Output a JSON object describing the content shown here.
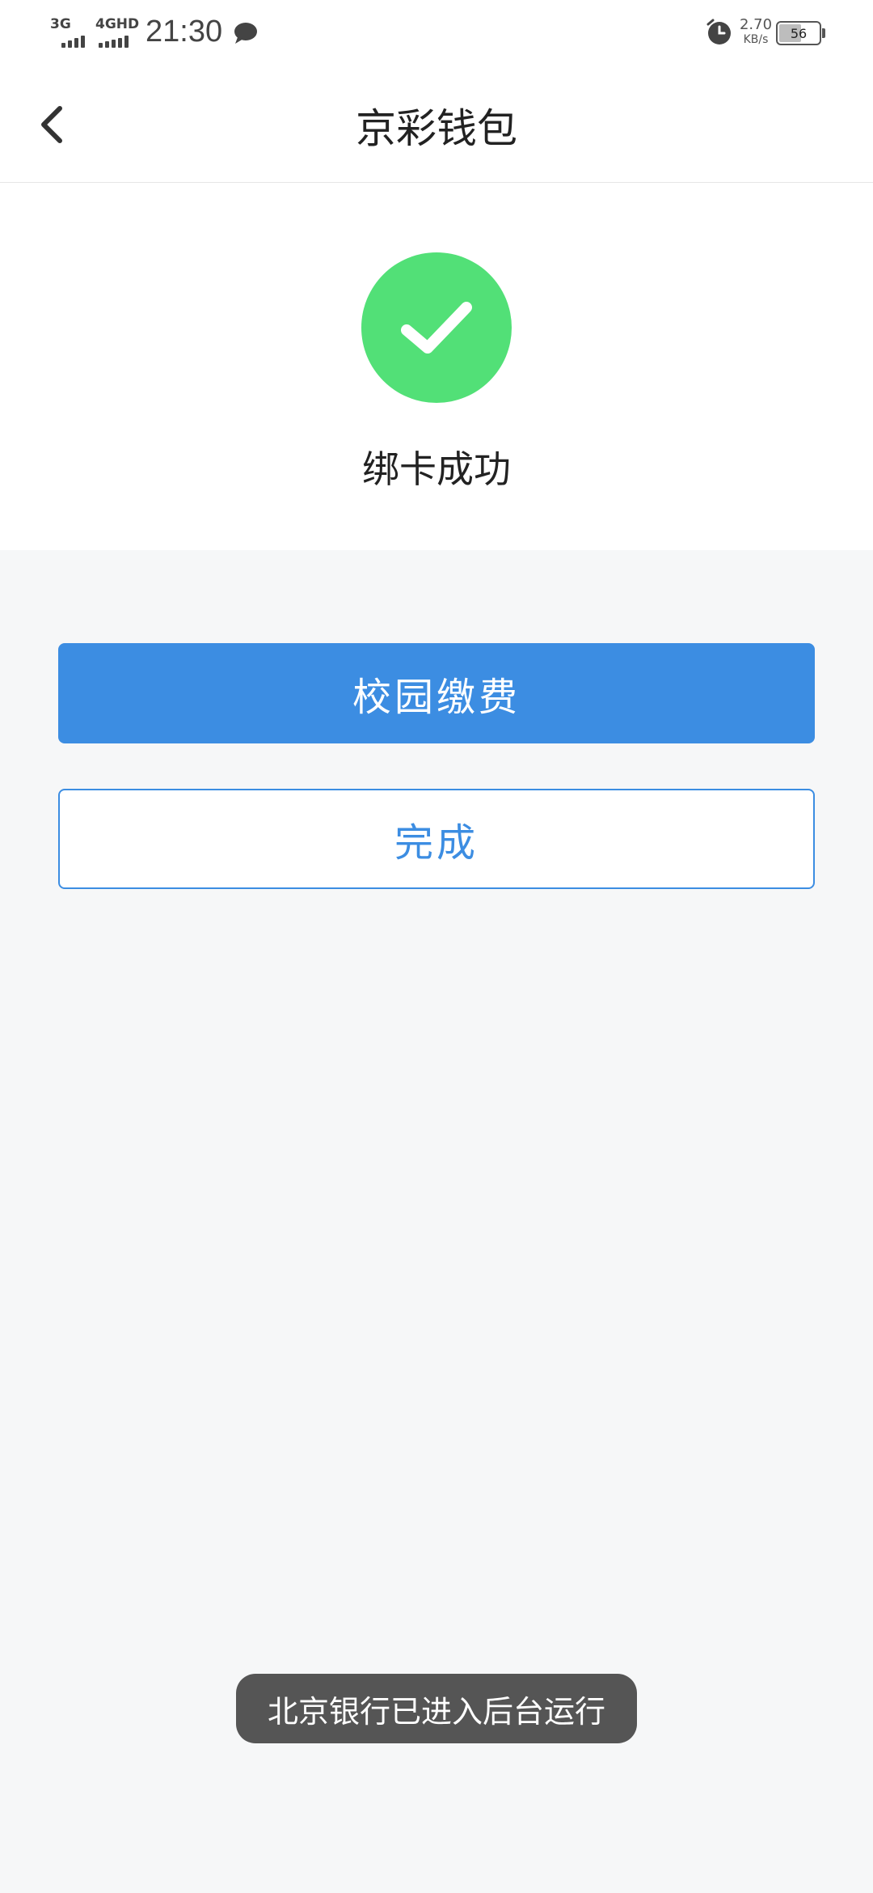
{
  "status_bar": {
    "signal1_label": "3G",
    "signal2_label": "4GHD",
    "time": "21:30",
    "net_speed_value": "2.70",
    "net_speed_unit": "KB/s",
    "battery_level": "56",
    "icons": [
      "message-icon",
      "alarm-icon"
    ]
  },
  "header": {
    "title": "京彩钱包",
    "back_icon": "chevron-left-icon"
  },
  "result": {
    "icon": "check-circle-icon",
    "icon_color": "#52e077",
    "message": "绑卡成功"
  },
  "actions": {
    "primary_label": "校园缴费",
    "secondary_label": "完成",
    "accent_color": "#3c8de2"
  },
  "toast": {
    "message": "北京银行已进入后台运行"
  }
}
